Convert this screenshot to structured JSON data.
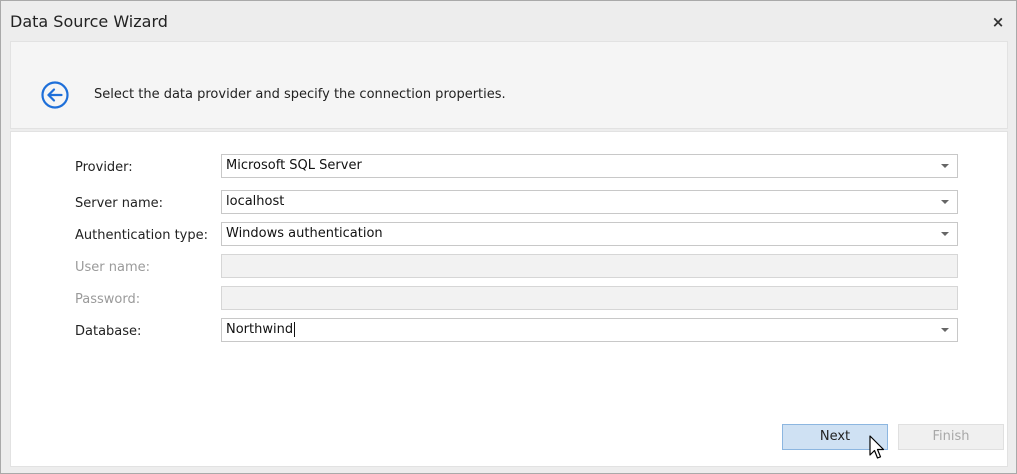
{
  "window": {
    "title": "Data Source Wizard",
    "close_symbol": "×"
  },
  "header": {
    "back_icon": "arrow-left-circle-icon",
    "instruction": "Select the data provider and specify the connection properties.",
    "accent_color": "#1e6fd9"
  },
  "form": {
    "provider": {
      "label": "Provider:",
      "value": "Microsoft SQL Server"
    },
    "server_name": {
      "label": "Server name:",
      "value": "localhost"
    },
    "authentication_type": {
      "label": "Authentication type:",
      "value": "Windows authentication"
    },
    "user_name": {
      "label": "User name:",
      "value": ""
    },
    "password": {
      "label": "Password:",
      "value": ""
    },
    "database": {
      "label": "Database:",
      "value": "Northwind"
    }
  },
  "buttons": {
    "next": "Next",
    "finish": "Finish"
  }
}
